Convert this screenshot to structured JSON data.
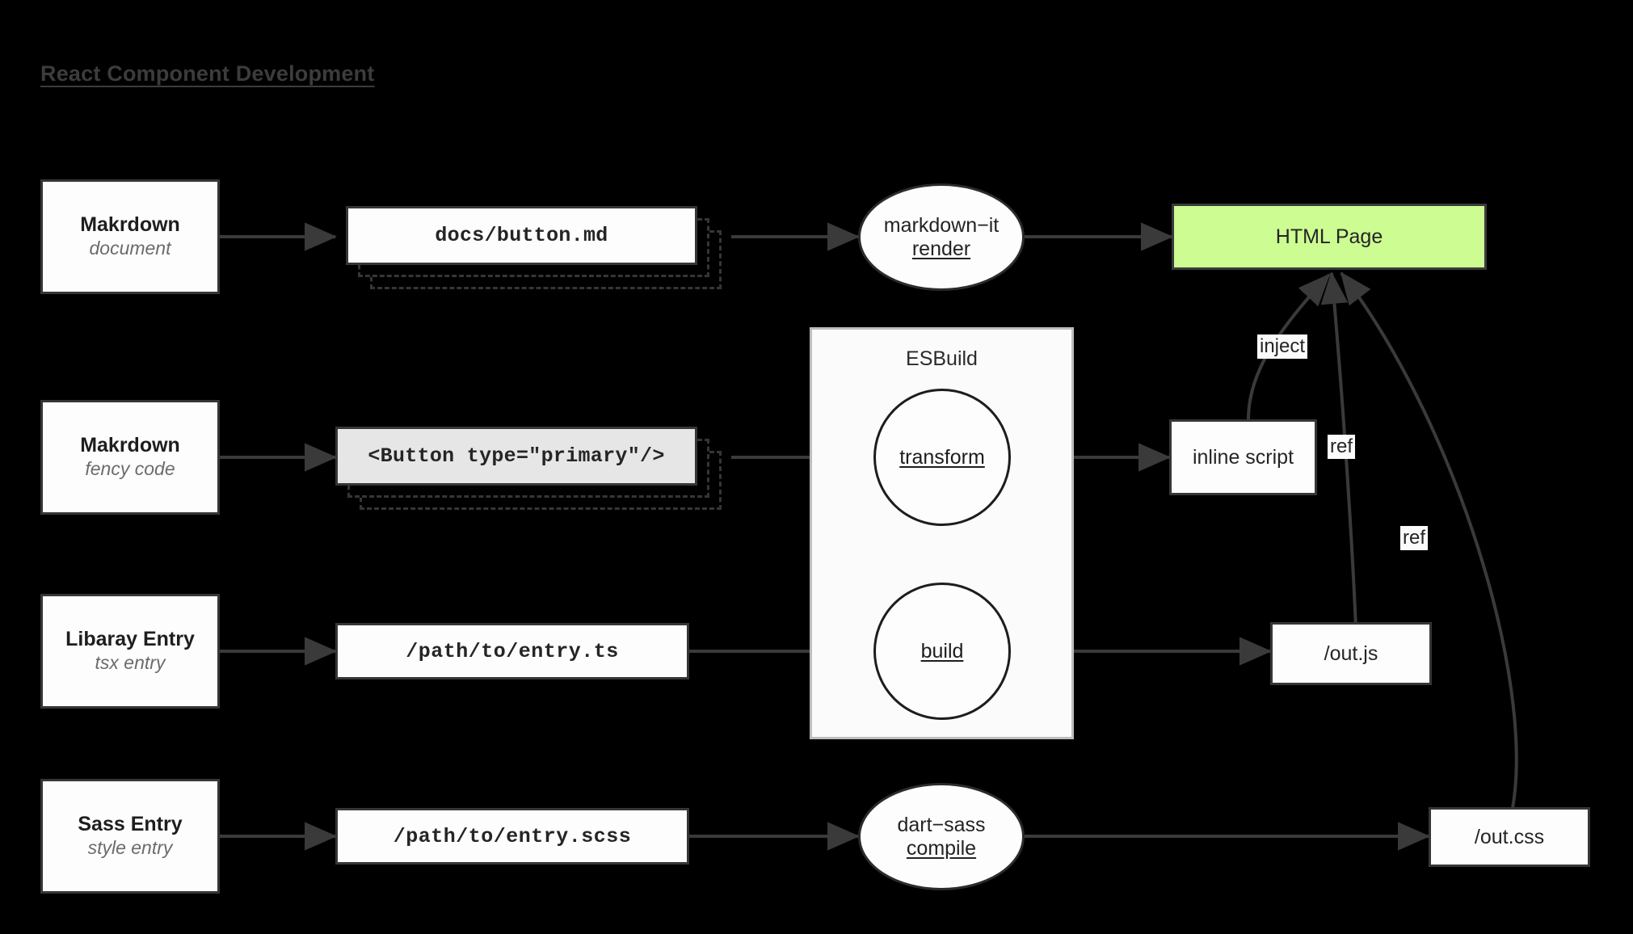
{
  "title": "React Component Development",
  "colors": {
    "background": "#000000",
    "node_fill": "#fdfdfd",
    "node_stroke": "#363636",
    "title_color": "#3c3c3c",
    "html_page_fill": "#ccfc92",
    "code_fill": "#e6e6e6",
    "container_stroke": "#bdbdbd",
    "subtitle_color": "#6b6b6b"
  },
  "sources": [
    {
      "title": "Makrdown",
      "subtitle": "document"
    },
    {
      "title": "Makrdown",
      "subtitle": "fency code"
    },
    {
      "title": "Libaray Entry",
      "subtitle": "tsx entry"
    },
    {
      "title": "Sass Entry",
      "subtitle": "style entry"
    }
  ],
  "artifacts": [
    {
      "label": "docs/button.md",
      "style": "stack"
    },
    {
      "label": "<Button type=\"primary\"/>",
      "style": "stack-code"
    },
    {
      "label": "/path/to/entry.ts",
      "style": "plain"
    },
    {
      "label": "/path/to/entry.scss",
      "style": "plain"
    }
  ],
  "processors": {
    "markdown_it": {
      "name": "markdown−it",
      "op": "render"
    },
    "dart_sass": {
      "name": "dart−sass",
      "op": "compile"
    }
  },
  "esbuild": {
    "label": "ESBuild",
    "operations": [
      {
        "op": "transform"
      },
      {
        "op": "build"
      }
    ]
  },
  "outputs": {
    "html_page": "HTML Page",
    "inline_script": "inline script",
    "out_js": "/out.js",
    "out_css": "/out.css"
  },
  "edge_labels": {
    "inject": "inject",
    "ref_top": "ref",
    "ref_bottom": "ref"
  }
}
